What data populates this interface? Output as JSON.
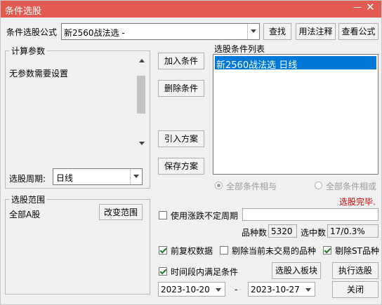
{
  "window": {
    "title": "条件选股",
    "minimize": "—",
    "close": "✕"
  },
  "formula": {
    "label": "条件选股公式",
    "value": "新2560战法选 -",
    "find": "查找",
    "usage": "用法注释",
    "view": "查看公式"
  },
  "params": {
    "group_label": "计算参数",
    "text": "无参数需要设置"
  },
  "period": {
    "label": "选股周期:",
    "value": "日线"
  },
  "actions": {
    "add": "加入条件",
    "delete": "删除条件",
    "import": "引入方案",
    "save": "保存方案"
  },
  "condlist": {
    "label": "选股条件列表",
    "items": [
      "新2560战法选  日线"
    ]
  },
  "logic": {
    "all_and": "全部条件相与",
    "all_or": "全部条件相或"
  },
  "status": {
    "done": "选股完毕.",
    "done_color": "#cc0000"
  },
  "scope": {
    "group_label": "选股范围",
    "value": "全部A股",
    "change": "改变范围"
  },
  "options": {
    "variable_period": "使用涨跌不定周期",
    "count_label": "品种数",
    "count_value": "5320",
    "selected_label": "选中数",
    "selected_value": "17/0.3%",
    "pre_adjust": "前复权数据",
    "exclude_untraded": "剔除当前未交易的品种",
    "exclude_st": "剔除ST品种",
    "in_period": "时间段内满足条件"
  },
  "date": {
    "start": "2023-10-20",
    "sep": "-",
    "end": "2023-10-27"
  },
  "bottom": {
    "to_block": "选股入板块",
    "execute": "执行选股",
    "close": "关闭"
  }
}
